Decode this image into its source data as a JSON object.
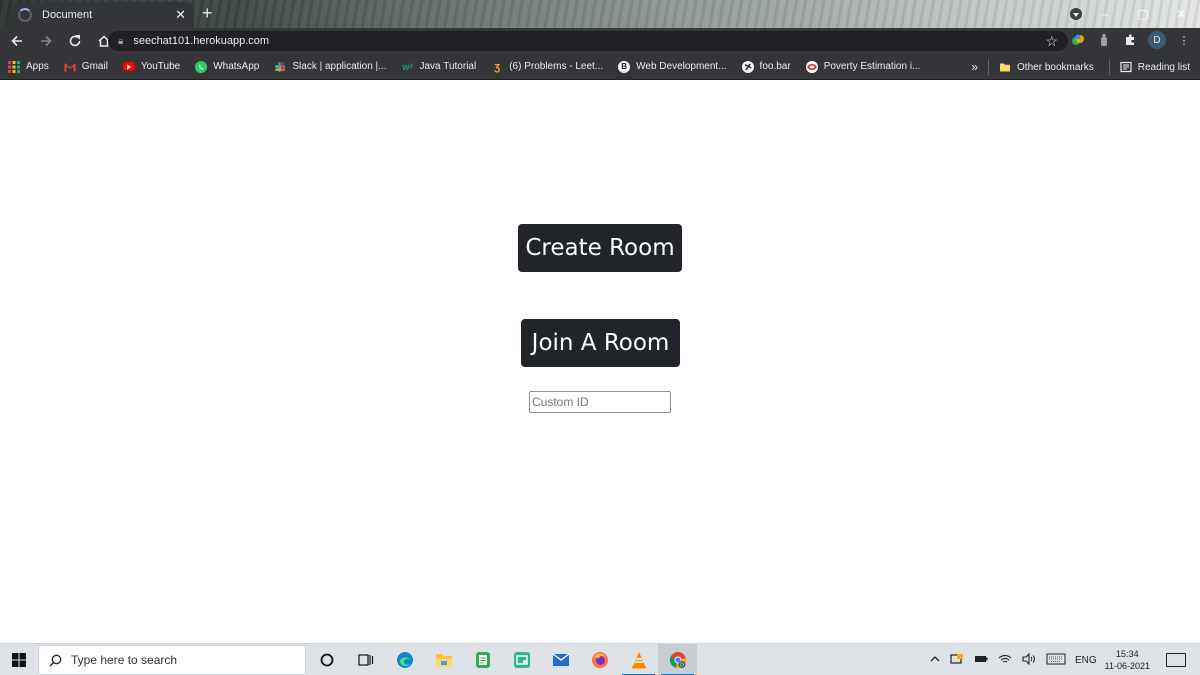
{
  "browser": {
    "tab_title": "Document",
    "tab_close": "✕",
    "new_tab": "+",
    "url": "seechat101.herokuapp.com",
    "profile_initial": "D"
  },
  "bookmarks": [
    {
      "label": "Apps",
      "icon": "apps-grid-icon",
      "color": "#ea4335"
    },
    {
      "label": "Gmail",
      "icon": "gmail-icon",
      "color": "#ea4335"
    },
    {
      "label": "YouTube",
      "icon": "youtube-icon",
      "color": "#ff0000"
    },
    {
      "label": "WhatsApp",
      "icon": "whatsapp-icon",
      "color": "#25d366"
    },
    {
      "label": "Slack | application |...",
      "icon": "slack-icon",
      "color": "#4a154b"
    },
    {
      "label": "Java Tutorial",
      "icon": "w3schools-icon",
      "color": "#04aa6d"
    },
    {
      "label": "(6) Problems - Leet...",
      "icon": "leetcode-icon",
      "color": "#ffa116"
    },
    {
      "label": "Web Development...",
      "icon": "web-dev-icon",
      "color": "#f1f3f4"
    },
    {
      "label": "foo.bar",
      "icon": "globe-icon",
      "color": "#f1f3f4"
    },
    {
      "label": "Poverty Estimation i...",
      "icon": "poverty-site-icon",
      "color": "#d93025"
    }
  ],
  "bookmarks_right": {
    "more": "»",
    "other": "Other bookmarks",
    "reading": "Reading list"
  },
  "page": {
    "create_label": "Create Room",
    "join_label": "Join A Room",
    "custom_id_placeholder": "Custom ID"
  },
  "taskbar": {
    "search_placeholder": "Type here to search",
    "lang": "ENG",
    "time": "15:34",
    "date": "11-06-2021"
  }
}
